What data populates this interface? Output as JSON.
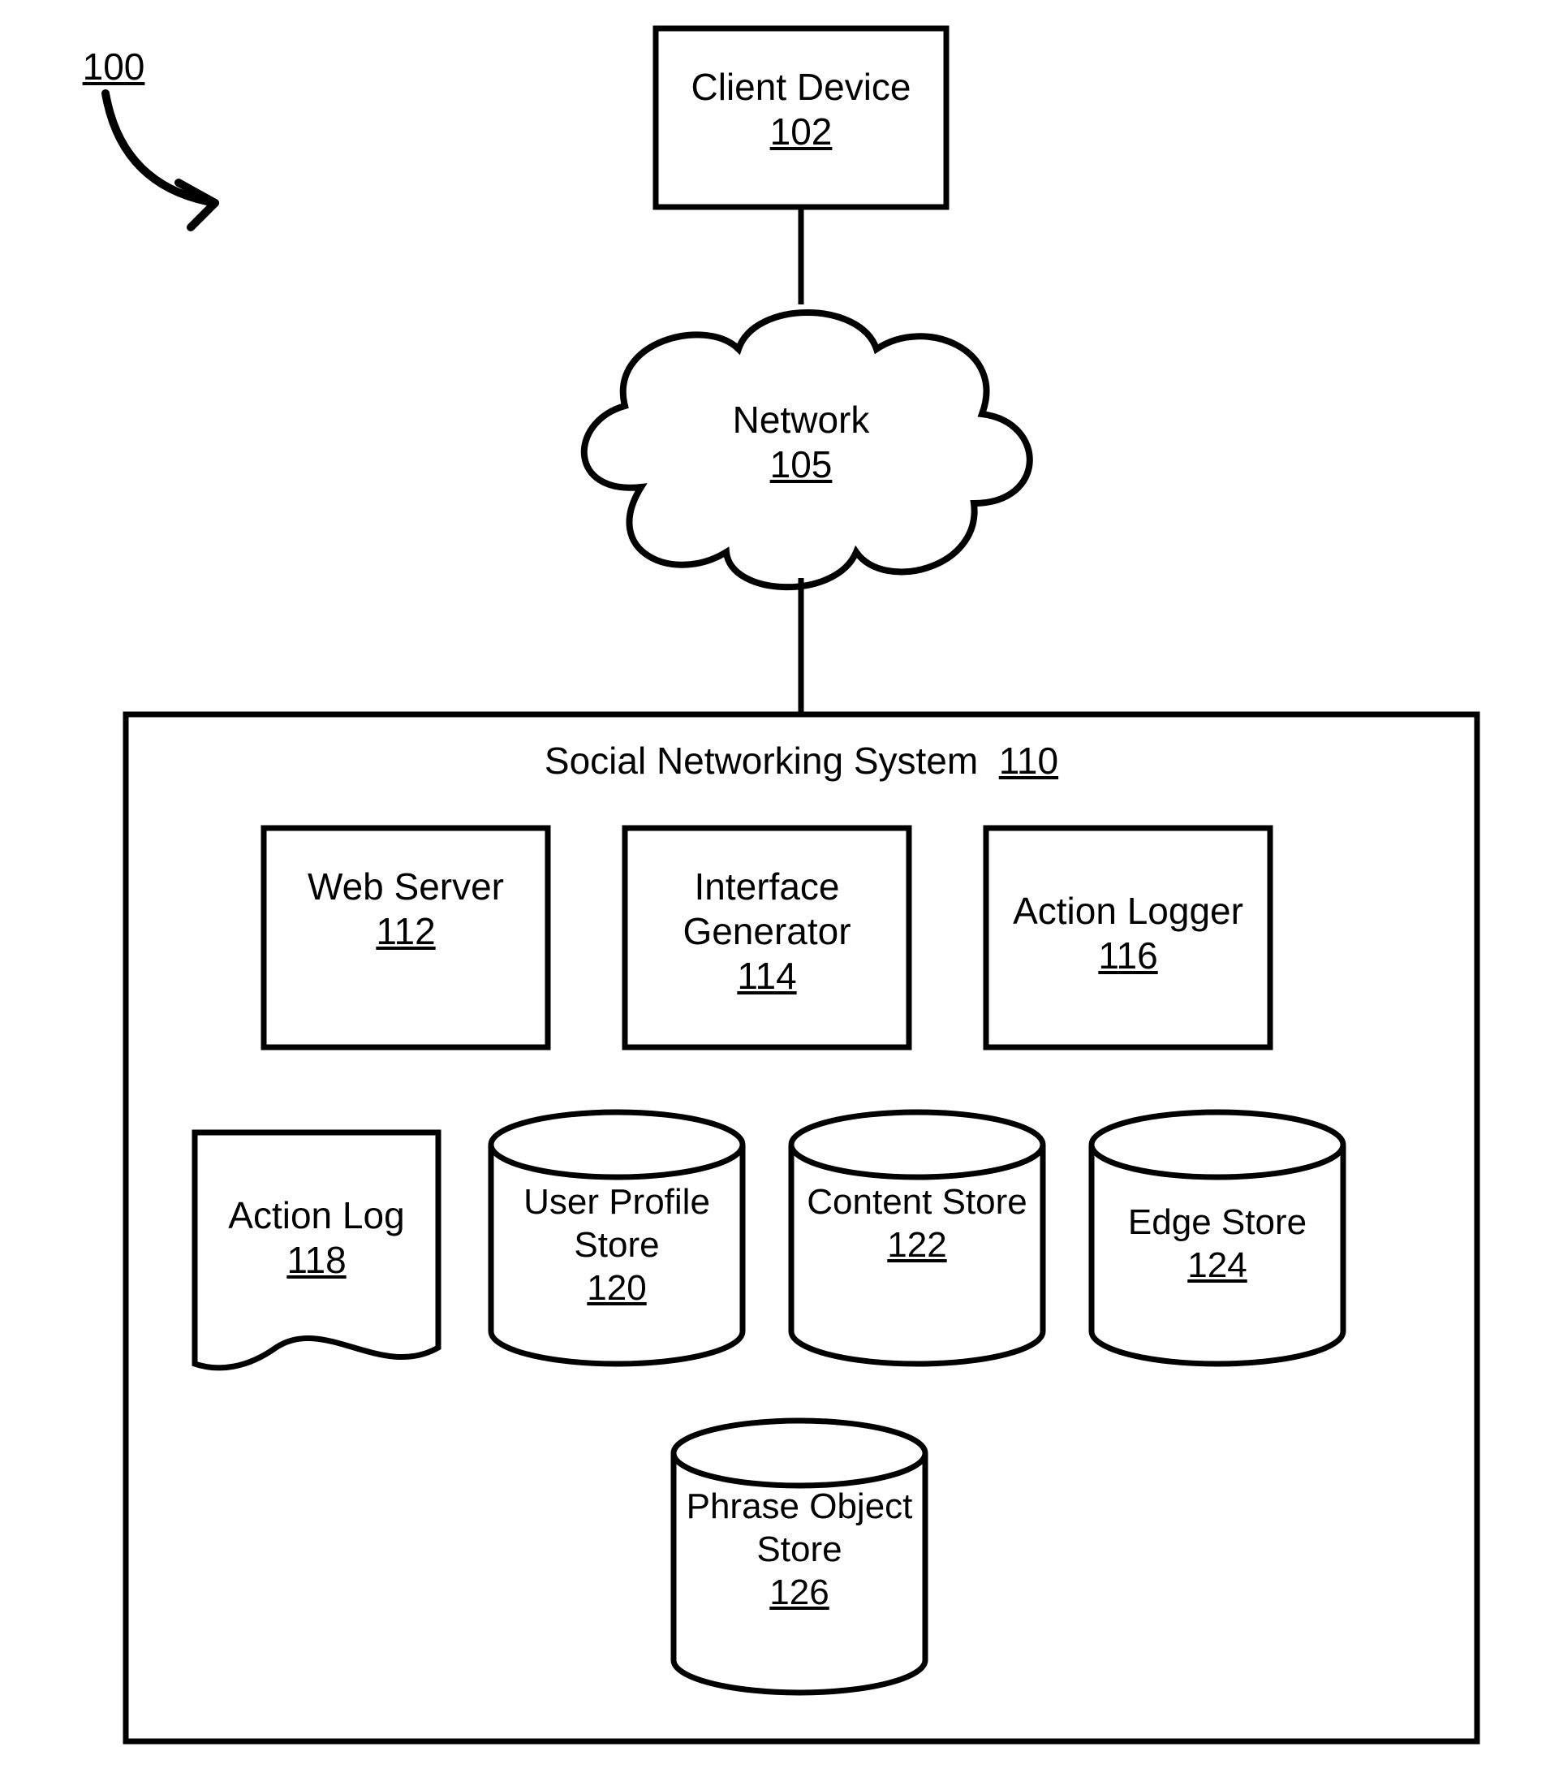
{
  "figure_ref": "100",
  "client_device": {
    "label": "Client Device",
    "ref": "102"
  },
  "network": {
    "label": "Network",
    "ref": "105"
  },
  "system": {
    "title": "Social Networking System",
    "ref": "110",
    "row_modules": [
      {
        "label": "Web Server",
        "ref": "112"
      },
      {
        "label": "Interface Generator",
        "ref": "114"
      },
      {
        "label": "Action Logger",
        "ref": "116"
      }
    ],
    "action_log": {
      "label": "Action Log",
      "ref": "118"
    },
    "stores_row": [
      {
        "label": "User Profile Store",
        "ref": "120"
      },
      {
        "label": "Content Store",
        "ref": "122"
      },
      {
        "label": "Edge Store",
        "ref": "124"
      }
    ],
    "phrase_store": {
      "label": "Phrase Object Store",
      "ref": "126"
    }
  }
}
